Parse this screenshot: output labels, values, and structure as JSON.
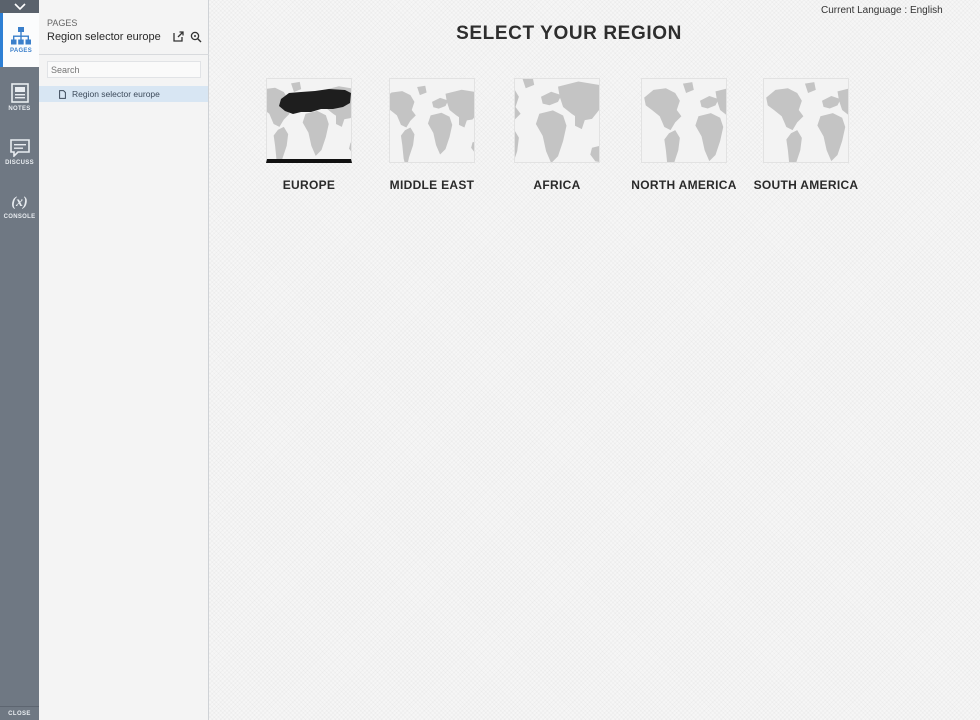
{
  "rail": {
    "items": [
      {
        "label": "PAGES",
        "icon": "sitemap-icon"
      },
      {
        "label": "NOTES",
        "icon": "notes-icon"
      },
      {
        "label": "DISCUSS",
        "icon": "comment-icon"
      },
      {
        "label": "CONSOLE",
        "icon": "console-icon",
        "glyph": "(x)"
      }
    ],
    "close_label": "CLOSE"
  },
  "panel": {
    "kicker": "PAGES",
    "title": "Region selector europe",
    "search_placeholder": "Search",
    "items": [
      {
        "label": "Region selector europe"
      }
    ]
  },
  "header": {
    "language_label": "Current Language : English"
  },
  "main": {
    "title": "SELECT YOUR REGION",
    "regions": [
      {
        "label": "EUROPE",
        "selected": true
      },
      {
        "label": "MIDDLE EAST",
        "selected": false
      },
      {
        "label": "AFRICA",
        "selected": false
      },
      {
        "label": "NORTH AMERICA",
        "selected": false
      },
      {
        "label": "SOUTH AMERICA",
        "selected": false
      }
    ]
  },
  "colors": {
    "rail_bg": "#6f7883",
    "accent": "#2d7fd4",
    "map_land": "#c4c4c4",
    "map_highlight": "#1e1e1e"
  }
}
